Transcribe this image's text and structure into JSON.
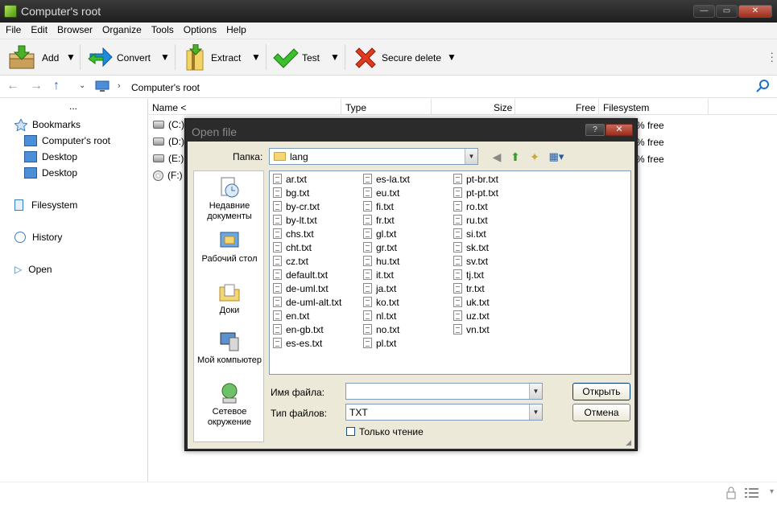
{
  "window": {
    "title": "Computer's root"
  },
  "menu": [
    "File",
    "Edit",
    "Browser",
    "Organize",
    "Tools",
    "Options",
    "Help"
  ],
  "toolbar": {
    "add": "Add",
    "convert": "Convert",
    "extract": "Extract",
    "test": "Test",
    "secure_delete": "Secure delete"
  },
  "address": {
    "path": "Computer's root"
  },
  "sidebar": {
    "more": "...",
    "bookmarks": "Bookmarks",
    "bookmark_items": [
      "Computer's root",
      "Desktop",
      "Desktop"
    ],
    "filesystem": "Filesystem",
    "history": "History",
    "open": "Open"
  },
  "columns": {
    "name": "Name <",
    "type": "Type",
    "size": "Size",
    "free": "Free",
    "filesystem": "Filesystem"
  },
  "drives": [
    {
      "label": "(C:)",
      "free": "% free"
    },
    {
      "label": "(D:)",
      "free": "% free"
    },
    {
      "label": "(E:)",
      "free": "% free"
    },
    {
      "label": "(F:)",
      "free": ""
    }
  ],
  "dialog": {
    "title": "Open file",
    "help_btn": "?",
    "close_btn": "✕",
    "lookin_label": "Папка:",
    "lookin_value": "lang",
    "places": [
      "Недавние документы",
      "Рабочий стол",
      "Доки",
      "Мой компьютер",
      "Сетевое окружение"
    ],
    "files_col1": [
      "ar.txt",
      "bg.txt",
      "by-cr.txt",
      "by-lt.txt",
      "chs.txt",
      "cht.txt",
      "cz.txt",
      "default.txt",
      "de-uml.txt",
      "de-uml-alt.txt",
      "en.txt",
      "en-gb.txt",
      "es-es.txt"
    ],
    "files_col2": [
      "es-la.txt",
      "eu.txt",
      "fi.txt",
      "fr.txt",
      "gl.txt",
      "gr.txt",
      "hu.txt",
      "it.txt",
      "ja.txt",
      "ko.txt",
      "nl.txt",
      "no.txt",
      "pl.txt"
    ],
    "files_col3": [
      "pt-br.txt",
      "pt-pt.txt",
      "ro.txt",
      "ru.txt",
      "si.txt",
      "sk.txt",
      "sv.txt",
      "tj.txt",
      "tr.txt",
      "uk.txt",
      "uz.txt",
      "vn.txt"
    ],
    "filename_label": "Имя файла:",
    "filename_value": "",
    "filetype_label": "Тип файлов:",
    "filetype_value": "TXT",
    "open_btn": "Открыть",
    "cancel_btn": "Отмена",
    "readonly_label": "Только чтение"
  }
}
